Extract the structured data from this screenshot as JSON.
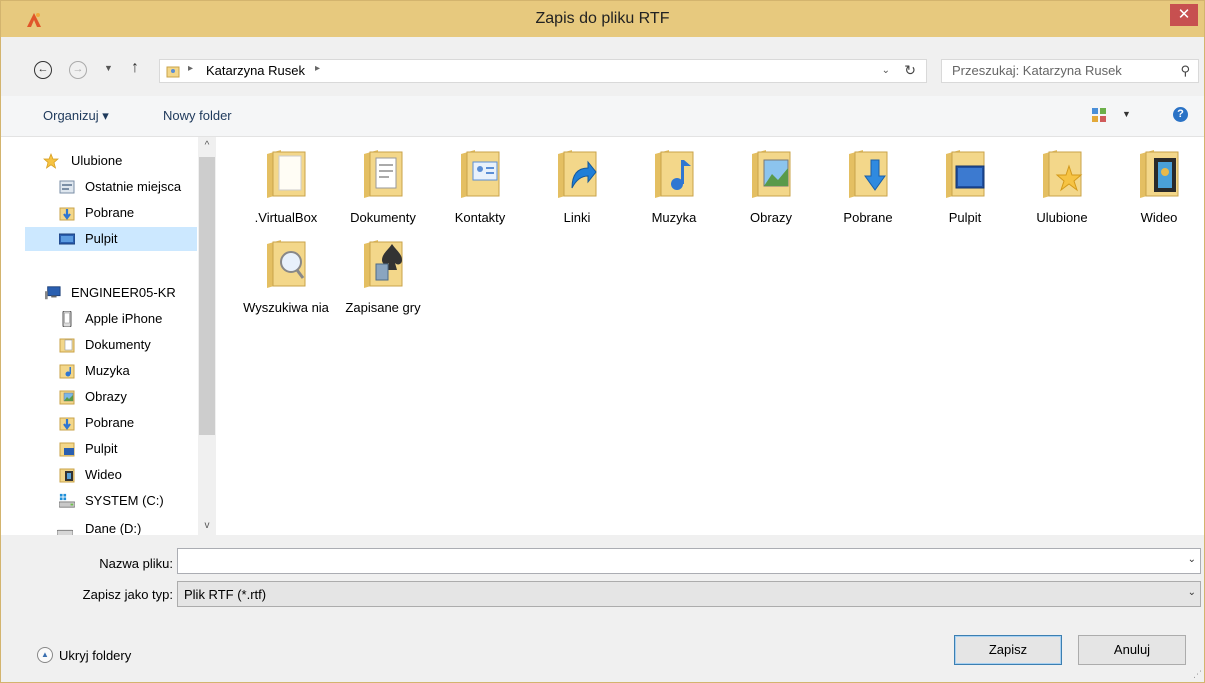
{
  "window": {
    "title": "Zapis do pliku RTF",
    "close_glyph": "✕",
    "app_icon": "app-icon"
  },
  "address": {
    "path_user": "Katarzyna Rusek",
    "separator": "▸",
    "dropdown_glyph": "⌄",
    "refresh_glyph": "↻"
  },
  "search": {
    "placeholder": "Przeszukaj: Katarzyna Rusek",
    "icon": "search-icon",
    "glyph": "⚲"
  },
  "nav_buttons": {
    "back": "←",
    "forward": "→",
    "dropdown": "▼",
    "up": "↑"
  },
  "toolbar": {
    "organize_label": "Organizuj ▾",
    "new_folder_label": "Nowy folder",
    "view_dropdown": "▼",
    "help_glyph": "?"
  },
  "navpane": {
    "items": [
      {
        "label": "Ulubione",
        "icon": "star-icon"
      },
      {
        "label": "Ostatnie miejsca",
        "icon": "recent-places-icon"
      },
      {
        "label": "Pobrane",
        "icon": "downloads-icon"
      },
      {
        "label": "Pulpit",
        "icon": "desktop-icon",
        "selected": true
      },
      {
        "label": "ENGINEER05-KR",
        "icon": "computer-icon"
      },
      {
        "label": "Apple iPhone",
        "icon": "phone-icon"
      },
      {
        "label": "Dokumenty",
        "icon": "documents-icon"
      },
      {
        "label": "Muzyka",
        "icon": "music-icon"
      },
      {
        "label": "Obrazy",
        "icon": "pictures-icon"
      },
      {
        "label": "Pobrane",
        "icon": "downloads-icon"
      },
      {
        "label": "Pulpit",
        "icon": "desktop-icon"
      },
      {
        "label": "Wideo",
        "icon": "videos-icon"
      },
      {
        "label": "SYSTEM (C:)",
        "icon": "drive-icon"
      },
      {
        "label": "Dane (D:)",
        "icon": "drive-icon"
      }
    ],
    "scroll_up": "^",
    "scroll_down": "v"
  },
  "folders": [
    {
      "label": ".VirtualBox",
      "overlay": "none"
    },
    {
      "label": "Dokumenty",
      "overlay": "documents"
    },
    {
      "label": "Kontakty",
      "overlay": "contacts"
    },
    {
      "label": "Linki",
      "overlay": "links"
    },
    {
      "label": "Muzyka",
      "overlay": "music"
    },
    {
      "label": "Obrazy",
      "overlay": "pictures"
    },
    {
      "label": "Pobrane",
      "overlay": "downloads"
    },
    {
      "label": "Pulpit",
      "overlay": "desktop"
    },
    {
      "label": "Ulubione",
      "overlay": "favorites"
    },
    {
      "label": "Wideo",
      "overlay": "videos"
    },
    {
      "label": "Wyszukiwa nia",
      "overlay": "searches"
    },
    {
      "label": "Zapisane gry",
      "overlay": "saved-games"
    }
  ],
  "form": {
    "filename_label": "Nazwa pliku:",
    "filename_value": "",
    "filetype_label": "Zapisz jako typ:",
    "filetype_value": "Plik RTF (*.rtf)",
    "dropdown_glyph": "⌄"
  },
  "footer": {
    "hide_folders_label": "Ukryj foldery",
    "hide_folders_glyph": "▲",
    "save_label": "Zapisz",
    "cancel_label": "Anuluj",
    "grip_glyph": "⋰"
  },
  "colors": {
    "titlebar": "#e7c97e",
    "close": "#c75050",
    "selection": "#cce8ff",
    "link": "#1e395b",
    "folder": "#f3d78a"
  }
}
